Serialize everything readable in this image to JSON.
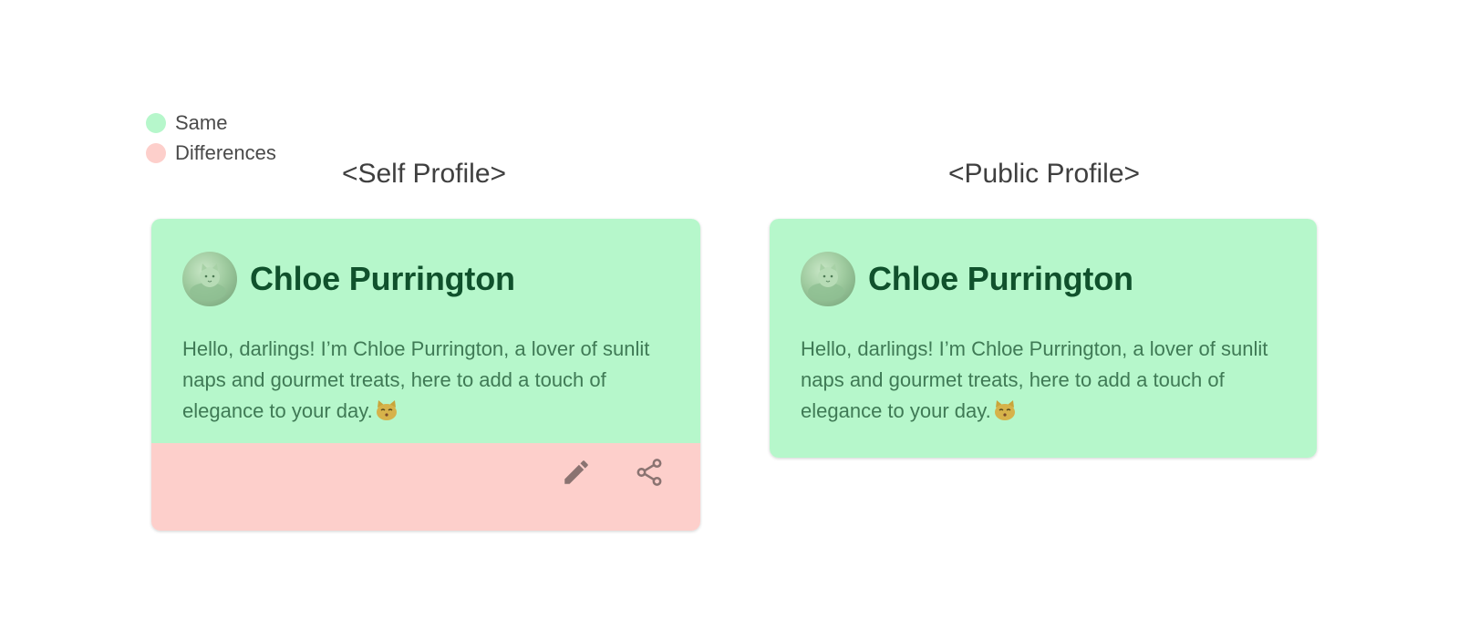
{
  "legend": {
    "items": [
      {
        "label": "Same",
        "color": "#b6f7cb"
      },
      {
        "label": "Differences",
        "color": "#fdcfcb"
      }
    ]
  },
  "panels": {
    "self": {
      "title": "<Self Profile>",
      "name": "Chloe Purrington",
      "bio": "Hello, darlings! I’m Chloe Purrington, a lover of sunlit naps and gourmet treats, here to add a touch of elegance to your day.",
      "actions": [
        {
          "icon": "pencil-icon",
          "label": "Edit"
        },
        {
          "icon": "share-icon",
          "label": "Share"
        }
      ]
    },
    "public": {
      "title": "<Public Profile>",
      "name": "Chloe Purrington",
      "bio": "Hello, darlings! I’m Chloe Purrington, a lover of sunlit naps and gourmet treats, here to add a touch of elegance to your day."
    }
  },
  "colors": {
    "same": "#b6f7cb",
    "difference": "#fdcfcb",
    "name": "#10512c",
    "bio": "#3f7a55",
    "icon": "#8a7371"
  }
}
